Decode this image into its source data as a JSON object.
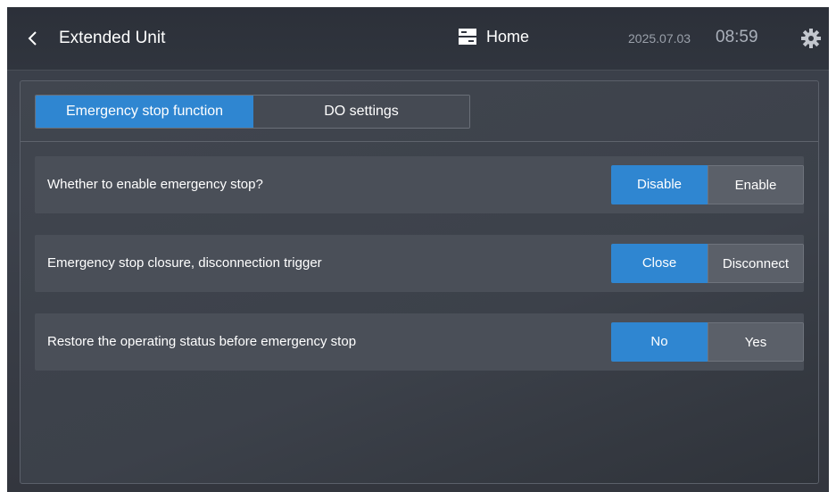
{
  "header": {
    "back_icon": "chevron-left-icon",
    "title": "Extended Unit",
    "home_icon": "home-panel-icon",
    "home_label": "Home",
    "date": "2025.07.03",
    "time": "08:59",
    "settings_icon": "gear-icon"
  },
  "tabs": [
    {
      "label": "Emergency stop function",
      "active": true
    },
    {
      "label": "DO settings",
      "active": false
    }
  ],
  "settings": [
    {
      "label": "Whether to enable emergency stop?",
      "options": [
        "Disable",
        "Enable"
      ],
      "selected": "Disable"
    },
    {
      "label": "Emergency stop closure, disconnection trigger",
      "options": [
        "Close",
        "Disconnect"
      ],
      "selected": "Close"
    },
    {
      "label": "Restore the operating status before emergency stop",
      "options": [
        "No",
        "Yes"
      ],
      "selected": "No"
    }
  ],
  "colors": {
    "accent": "#2f86d1",
    "background": "#3c414a",
    "row": "#4a4f58"
  }
}
